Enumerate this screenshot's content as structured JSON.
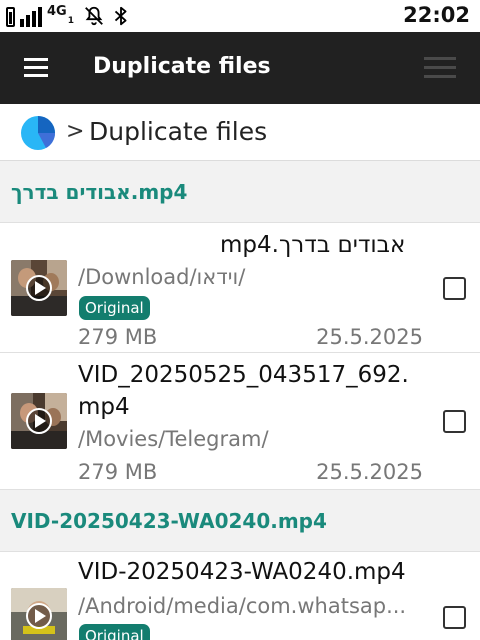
{
  "status_bar": {
    "network_label": "4G",
    "network_sub": "1",
    "time": "22:02",
    "icons": [
      "battery-icon",
      "signal-icon",
      "mute-notifications-icon",
      "bluetooth-icon"
    ]
  },
  "toolbar": {
    "title": "Duplicate files",
    "menu_icon": "hamburger-menu-icon",
    "overflow_icon": "overflow-menu-icon"
  },
  "breadcrumb": {
    "icon": "storage-pie-icon",
    "separator": ">",
    "label": "Duplicate files"
  },
  "colors": {
    "accent": "#1a8a7c",
    "badge": "#137d6e",
    "toolbar": "#212121"
  },
  "groups": [
    {
      "header": "אבודים בדרך.mp4",
      "files": [
        {
          "name": "אבודים בדרך.mp4",
          "path": "/Download/וידאו/",
          "badge": "Original",
          "size": "279 MB",
          "date": "25.5.2025",
          "checked": false
        },
        {
          "name": "VID_20250525_043517_692.mp4",
          "path": "/Movies/Telegram/",
          "size": "279 MB",
          "date": "25.5.2025",
          "checked": false
        }
      ]
    },
    {
      "header": "VID-20250423-WA0240.mp4",
      "files": [
        {
          "name": "VID-20250423-WA0240.mp4",
          "path": "/Android/media/com.whatsap...",
          "badge": "Original",
          "checked": false
        }
      ]
    }
  ]
}
